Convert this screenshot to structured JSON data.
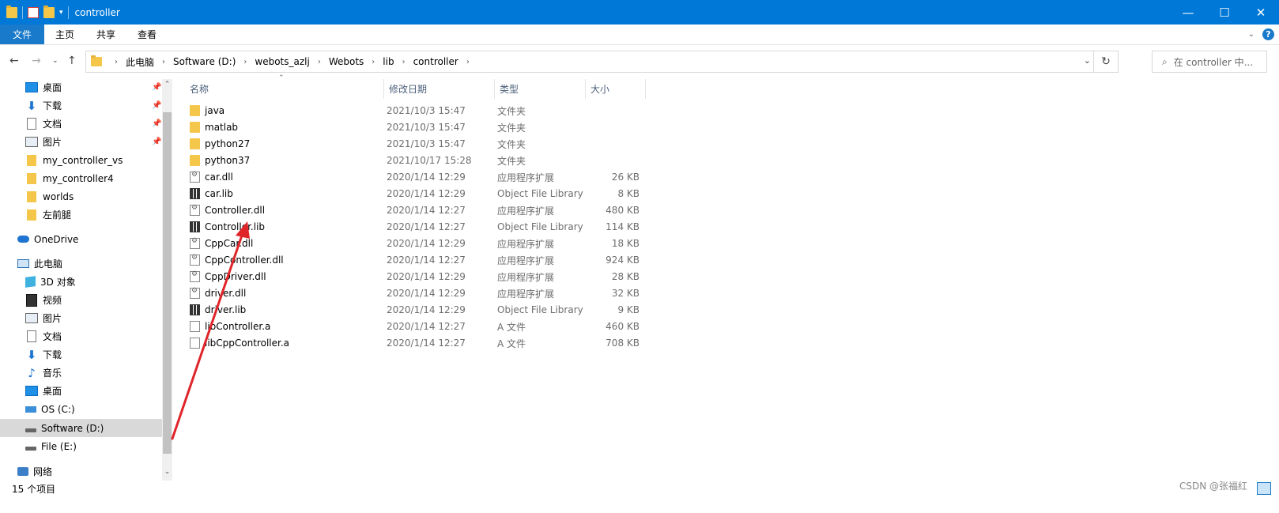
{
  "window": {
    "title": "controller",
    "minimize": "—",
    "maximize": "☐",
    "close": "✕"
  },
  "ribbon": {
    "tabs": [
      "文件",
      "主页",
      "共享",
      "查看"
    ],
    "help": "?"
  },
  "address": {
    "crumbs": [
      "此电脑",
      "Software (D:)",
      "webots_azlj",
      "Webots",
      "lib",
      "controller"
    ],
    "search_placeholder": "在 controller 中..."
  },
  "sidebar": {
    "items": [
      {
        "label": "桌面",
        "icon": "desktop-icon",
        "pinned": true
      },
      {
        "label": "下载",
        "icon": "download-icon",
        "pinned": true
      },
      {
        "label": "文档",
        "icon": "document-icon",
        "pinned": true
      },
      {
        "label": "图片",
        "icon": "picture-icon",
        "pinned": true
      },
      {
        "label": "my_controller_vs",
        "icon": "folder-icon",
        "pinned": false
      },
      {
        "label": "my_controller4",
        "icon": "folder-icon",
        "pinned": false
      },
      {
        "label": "worlds",
        "icon": "folder-icon",
        "pinned": false
      },
      {
        "label": "左前腿",
        "icon": "folder-icon",
        "pinned": false
      },
      {
        "label": "OneDrive",
        "icon": "onedrive-icon",
        "pinned": false
      },
      {
        "label": "此电脑",
        "icon": "this-pc-icon",
        "pinned": false
      },
      {
        "label": "3D 对象",
        "icon": "3d-objects-icon",
        "pinned": false
      },
      {
        "label": "视频",
        "icon": "video-icon",
        "pinned": false
      },
      {
        "label": "图片",
        "icon": "picture-icon",
        "pinned": false
      },
      {
        "label": "文档",
        "icon": "document-icon",
        "pinned": false
      },
      {
        "label": "下载",
        "icon": "download-icon",
        "pinned": false
      },
      {
        "label": "音乐",
        "icon": "music-icon",
        "pinned": false
      },
      {
        "label": "桌面",
        "icon": "desktop-icon",
        "pinned": false
      },
      {
        "label": "OS (C:)",
        "icon": "os-drive-icon",
        "pinned": false
      },
      {
        "label": "Software (D:)",
        "icon": "drive-icon",
        "pinned": false,
        "selected": true
      },
      {
        "label": "File (E:)",
        "icon": "drive-icon",
        "pinned": false
      },
      {
        "label": "网络",
        "icon": "network-icon",
        "pinned": false
      }
    ]
  },
  "columns": {
    "name": "名称",
    "date": "修改日期",
    "type": "类型",
    "size": "大小"
  },
  "files": [
    {
      "name": "java",
      "date": "2021/10/3 15:47",
      "type": "文件夹",
      "size": "",
      "icon": "folder"
    },
    {
      "name": "matlab",
      "date": "2021/10/3 15:47",
      "type": "文件夹",
      "size": "",
      "icon": "folder"
    },
    {
      "name": "python27",
      "date": "2021/10/3 15:47",
      "type": "文件夹",
      "size": "",
      "icon": "folder"
    },
    {
      "name": "python37",
      "date": "2021/10/17 15:28",
      "type": "文件夹",
      "size": "",
      "icon": "folder"
    },
    {
      "name": "car.dll",
      "date": "2020/1/14 12:29",
      "type": "应用程序扩展",
      "size": "26 KB",
      "icon": "dll"
    },
    {
      "name": "car.lib",
      "date": "2020/1/14 12:29",
      "type": "Object File Library",
      "size": "8 KB",
      "icon": "lib"
    },
    {
      "name": "Controller.dll",
      "date": "2020/1/14 12:27",
      "type": "应用程序扩展",
      "size": "480 KB",
      "icon": "dll"
    },
    {
      "name": "Controller.lib",
      "date": "2020/1/14 12:27",
      "type": "Object File Library",
      "size": "114 KB",
      "icon": "lib"
    },
    {
      "name": "CppCar.dll",
      "date": "2020/1/14 12:29",
      "type": "应用程序扩展",
      "size": "18 KB",
      "icon": "dll"
    },
    {
      "name": "CppController.dll",
      "date": "2020/1/14 12:27",
      "type": "应用程序扩展",
      "size": "924 KB",
      "icon": "dll"
    },
    {
      "name": "CppDriver.dll",
      "date": "2020/1/14 12:29",
      "type": "应用程序扩展",
      "size": "28 KB",
      "icon": "dll"
    },
    {
      "name": "driver.dll",
      "date": "2020/1/14 12:29",
      "type": "应用程序扩展",
      "size": "32 KB",
      "icon": "dll"
    },
    {
      "name": "driver.lib",
      "date": "2020/1/14 12:29",
      "type": "Object File Library",
      "size": "9 KB",
      "icon": "lib"
    },
    {
      "name": "libController.a",
      "date": "2020/1/14 12:27",
      "type": "A 文件",
      "size": "460 KB",
      "icon": "file"
    },
    {
      "name": "libCppController.a",
      "date": "2020/1/14 12:27",
      "type": "A 文件",
      "size": "708 KB",
      "icon": "file"
    }
  ],
  "status": {
    "count": "15 个项目"
  },
  "watermark": "CSDN @张福红",
  "colors": {
    "titlebar": "#0078d7",
    "file_tab": "#1979ca",
    "annotation": "#e0252a"
  }
}
